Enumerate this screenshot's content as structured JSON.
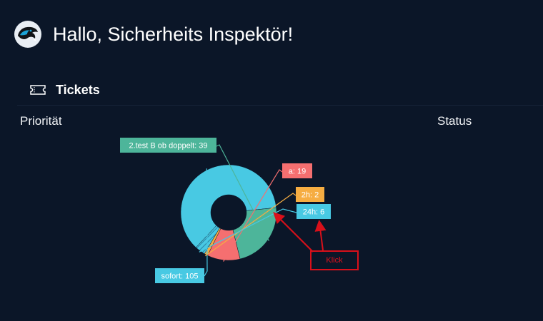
{
  "header": {
    "greeting": "Hallo, Sicherheits Inspektör!",
    "avatar_icon": "panther-logo-icon"
  },
  "section": {
    "title": "Tickets",
    "icon": "ticket-icon"
  },
  "columns": {
    "priority": "Priorität",
    "status": "Status"
  },
  "annotation": {
    "label": "Klick",
    "color": "#d9101a"
  },
  "chart_data": {
    "type": "pie",
    "variant": "donut",
    "slices": [
      {
        "label": "sofort: 105",
        "name": "sofort",
        "value": 105,
        "color": "#48c9e3"
      },
      {
        "label": "2.test B ob doppelt: 39",
        "name": "2.test B ob doppelt",
        "value": 39,
        "color": "#4db59a"
      },
      {
        "label": "a: 19",
        "name": "a",
        "value": 19,
        "color": "#f56f70"
      },
      {
        "label": "2h: 2",
        "name": "2h",
        "value": 2,
        "color": "#f6ad42"
      },
      {
        "label": "24h: 6",
        "name": "24h",
        "value": 6,
        "color": "#48c9e3"
      }
    ]
  }
}
